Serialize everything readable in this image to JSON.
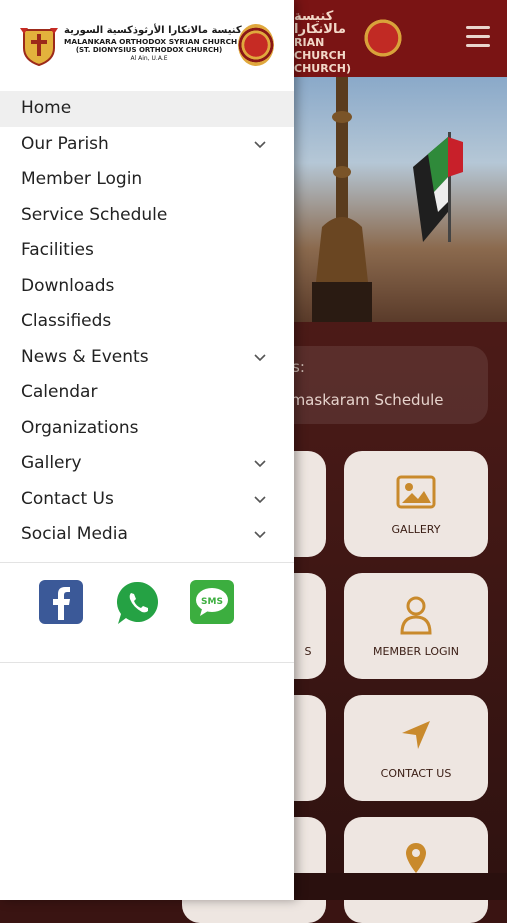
{
  "header": {
    "arabic": "كنيسة مالانكارا",
    "title_line1": "RIAN CHURCH",
    "title_line2": "CHURCH)"
  },
  "hero": {},
  "announcement": {
    "label": "s:",
    "text": "nt Namaskaram Schedule"
  },
  "tiles": [
    {
      "label": "GALLERY",
      "icon": "image-icon"
    },
    {
      "label": "MEMBER LOGIN",
      "icon": "user-icon"
    },
    {
      "label": "CONTACT US",
      "icon": "navigation-arrow-icon"
    },
    {
      "label": "",
      "icon": "location-pin-icon"
    }
  ],
  "left_tiles": [
    {
      "label": ""
    },
    {
      "label": "S"
    },
    {
      "label": ""
    },
    {
      "label": ""
    }
  ],
  "drawer": {
    "logo": {
      "arabic": "كنيسة مالانكارا الأرثوذكسية السورية",
      "line1": "MALANKARA ORTHODOX SYRIAN CHURCH",
      "line2": "(ST. DIONYSIUS ORTHODOX CHURCH)",
      "line3": "Al Ain, U.A.E"
    },
    "menu": [
      {
        "label": "Home",
        "expandable": false,
        "active": true
      },
      {
        "label": "Our Parish",
        "expandable": true
      },
      {
        "label": "Member Login",
        "expandable": false
      },
      {
        "label": "Service Schedule",
        "expandable": false
      },
      {
        "label": "Facilities",
        "expandable": false
      },
      {
        "label": "Downloads",
        "expandable": false
      },
      {
        "label": "Classifieds",
        "expandable": false
      },
      {
        "label": "News & Events",
        "expandable": true
      },
      {
        "label": "Calendar",
        "expandable": false
      },
      {
        "label": "Organizations",
        "expandable": false
      },
      {
        "label": "Gallery",
        "expandable": true
      },
      {
        "label": "Contact Us",
        "expandable": true
      },
      {
        "label": "Social Media",
        "expandable": true
      }
    ],
    "social": [
      {
        "name": "facebook-icon",
        "text": "f",
        "color": "#3b5998"
      },
      {
        "name": "whatsapp-icon",
        "text": "",
        "color": "#25a244"
      },
      {
        "name": "sms-icon",
        "text": "SMS",
        "color": "#3cae3f"
      }
    ]
  },
  "colors": {
    "header": "#7a1414",
    "tile": "#eee6e1",
    "accent_icon": "#c98a2c"
  }
}
